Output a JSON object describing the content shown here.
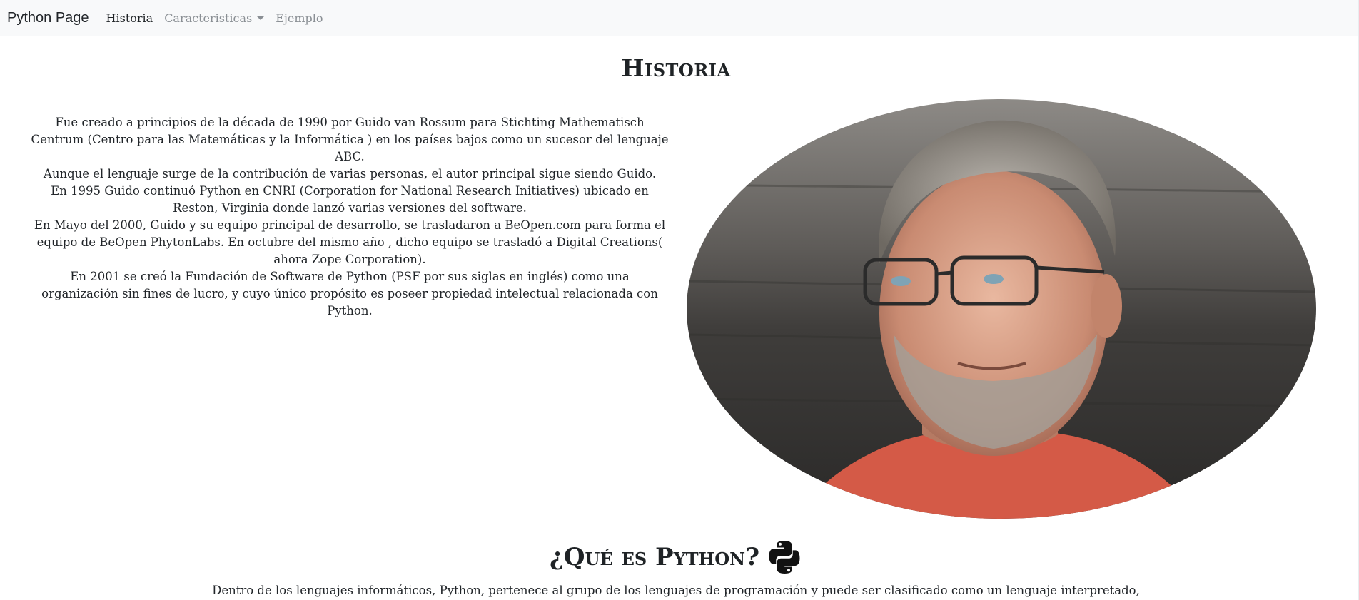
{
  "navbar": {
    "brand": "Python Page",
    "links": [
      {
        "label": "Historia",
        "active": true
      },
      {
        "label": "Caracteristicas",
        "dropdown": true
      },
      {
        "label": "Ejemplo"
      }
    ]
  },
  "historia": {
    "title": "Historia",
    "paragraphs": [
      "Fue creado a principios de la década de 1990 por Guido van Rossum para Stichting Mathematisch Centrum (Centro para las Matemáticas y la Informática ) en los países bajos como un sucesor del lenguaje ABC.",
      "Aunque el lenguaje surge de la contribución de varias personas, el autor principal sigue siendo Guido.",
      "En 1995 Guido continuó Python en CNRI (Corporation for National Research Initiatives) ubicado en Reston, Virginia donde lanzó varias versiones del software.",
      "En Mayo del 2000, Guido y su equipo principal de desarrollo, se trasladaron a BeOpen.com para forma el equipo de BeOpen PhytonLabs. En octubre del mismo año , dicho equipo se trasladó a Digital Creations( ahora Zope Corporation).",
      "En 2001 se creó la Fundación de Software de Python (PSF por sus siglas en inglés) como una organización sin fines de lucro, y cuyo único propósito es poseer propiedad intelectual relacionada con Python."
    ]
  },
  "que_es_python": {
    "title": "¿Qué es Python?",
    "intro": "Dentro de los lenguajes informáticos, Python, pertenece al grupo de los lenguajes de programación y puede ser clasificado como un lenguaje interpretado,"
  },
  "icons": {
    "python_logo": "python-logo-icon",
    "dropdown_caret": "chevron-down-icon",
    "portrait": "portrait-photo"
  },
  "colors": {
    "navbar_bg": "#f8f9fa",
    "text": "#212529",
    "muted_link": "#8a8f94",
    "shirt": "#d45a47"
  }
}
